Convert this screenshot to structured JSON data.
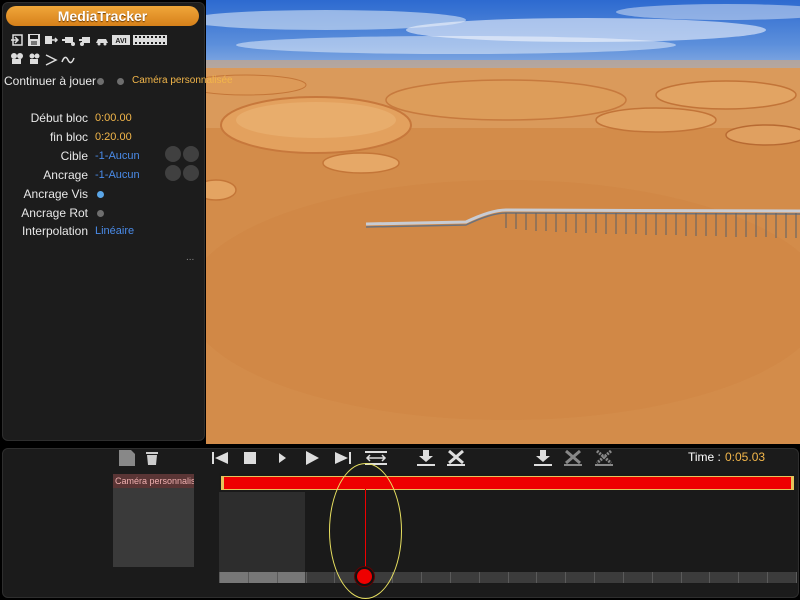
{
  "app": {
    "title": "MediaTracker"
  },
  "toolbar": {
    "row1": [
      "open-icon",
      "save-icon",
      "export-icon",
      "camera-add-icon",
      "camera-remove-icon",
      "car-icon",
      "avi-icon",
      "film-strip-icon"
    ],
    "row1_labels": {
      "avi": "AVI"
    },
    "row2": [
      "camera-icon",
      "camera-small-icon",
      "marker-icon",
      "path-icon"
    ]
  },
  "options": {
    "continue_label": "Continuer à jouer",
    "camera_label": "Caméra personnalisée"
  },
  "properties": {
    "start_label": "Début bloc",
    "start_value": "0:00.00",
    "end_label": "fin bloc",
    "end_value": "0:20.00",
    "target_label": "Cible",
    "target_value": "-1-Aucun",
    "anchor_label": "Ancrage",
    "anchor_value": "-1-Aucun",
    "anchor_vis_label": "Ancrage Vis",
    "anchor_rot_label": "Ancrage Rot",
    "interp_label": "Interpolation",
    "interp_value": "Linéaire",
    "more": "..."
  },
  "timeline": {
    "time_label": "Time :",
    "time_value": "0:05.03",
    "track_name": "Caméra personnalisée",
    "playhead_fraction": 0.253,
    "played_fraction": 0.149
  },
  "colors": {
    "accent": "#f2b64a",
    "link": "#4a8be8",
    "track_block": "#ee0000",
    "block_border": "#e6c35a",
    "highlight": "#e8e060"
  }
}
